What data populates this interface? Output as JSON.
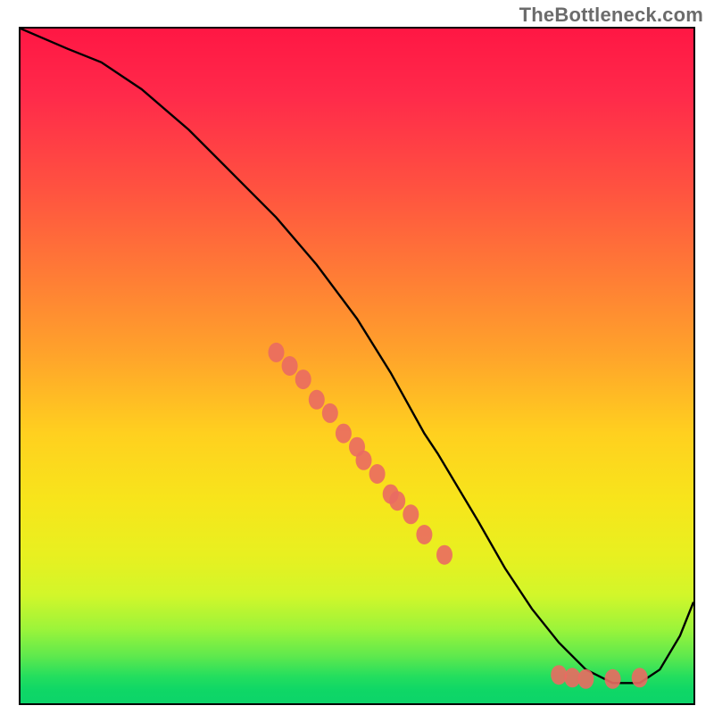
{
  "attribution": "TheBottleneck.com",
  "chart_data": {
    "type": "line",
    "title": "",
    "xlabel": "",
    "ylabel": "",
    "xlim": [
      0,
      100
    ],
    "ylim": [
      0,
      100
    ],
    "series": [
      {
        "name": "bottleneck-curve",
        "x": [
          0,
          7,
          12,
          18,
          25,
          32,
          38,
          44,
          50,
          55,
          60,
          62,
          65,
          68,
          72,
          76,
          80,
          84,
          88,
          90,
          92,
          95,
          98,
          100
        ],
        "y": [
          100,
          97,
          95,
          91,
          85,
          78,
          72,
          65,
          57,
          49,
          40,
          37,
          32,
          27,
          20,
          14,
          9,
          5,
          3,
          3,
          3,
          5,
          10,
          15
        ]
      }
    ],
    "markers": {
      "name": "highlighted-points",
      "color": "#ea6a62",
      "x": [
        38,
        40,
        42,
        44,
        46,
        48,
        50,
        51,
        53,
        55,
        56,
        58,
        60,
        63,
        80,
        82,
        84,
        88,
        92
      ],
      "y": [
        52,
        50,
        48,
        45,
        43,
        40,
        38,
        36,
        34,
        31,
        30,
        28,
        25,
        22,
        4.2,
        3.8,
        3.6,
        3.6,
        3.8
      ]
    },
    "gradient_stops": [
      {
        "pos": 0,
        "color": "#ff1744"
      },
      {
        "pos": 50,
        "color": "#ffa22b"
      },
      {
        "pos": 78,
        "color": "#e8f020"
      },
      {
        "pos": 96,
        "color": "#24de5e"
      },
      {
        "pos": 100,
        "color": "#0cd469"
      }
    ]
  }
}
